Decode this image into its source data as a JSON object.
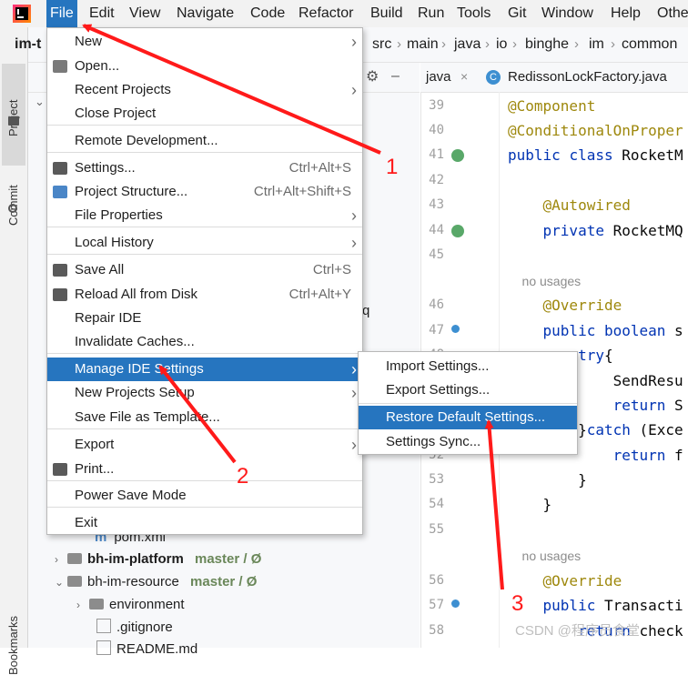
{
  "menubar": {
    "items": [
      "File",
      "Edit",
      "View",
      "Navigate",
      "Code",
      "Refactor",
      "Build",
      "Run",
      "Tools",
      "Git",
      "Window",
      "Help",
      "Othe"
    ]
  },
  "left_strip": {
    "project": "Project",
    "commit": "Commit",
    "bookmarks": "Bookmarks"
  },
  "navbar": {
    "project": "im-t",
    "crumbs": [
      "src",
      "main",
      "java",
      "io",
      "binghe",
      "im",
      "common"
    ]
  },
  "editor": {
    "tabs": [
      "java",
      "RedissonLockFactory.java"
    ],
    "lines": [
      {
        "n": "39",
        "code": "@Component"
      },
      {
        "n": "40",
        "code": "@ConditionalOnProper"
      },
      {
        "n": "41",
        "code": "public class RocketM"
      },
      {
        "n": "42",
        "code": ""
      },
      {
        "n": "43",
        "code": "    @Autowired"
      },
      {
        "n": "44",
        "code": "    private RocketMQ"
      },
      {
        "n": "45",
        "code": ""
      },
      {
        "n": "",
        "code": "    no usages"
      },
      {
        "n": "46",
        "code": "    @Override"
      },
      {
        "n": "47",
        "code": "    public boolean s"
      },
      {
        "n": "48",
        "code": "        try{"
      },
      {
        "n": "49",
        "code": "            SendResu"
      },
      {
        "n": "50",
        "code": "            return S"
      },
      {
        "n": "51",
        "code": "        }catch (Exce"
      },
      {
        "n": "52",
        "code": "            return f"
      },
      {
        "n": "53",
        "code": "        }"
      },
      {
        "n": "54",
        "code": "    }"
      },
      {
        "n": "55",
        "code": ""
      },
      {
        "n": "",
        "code": "    no usages"
      },
      {
        "n": "56",
        "code": "    @Override"
      },
      {
        "n": "57",
        "code": "    public Transacti"
      },
      {
        "n": "58",
        "code": "        return check"
      }
    ]
  },
  "tree": {
    "pom": "pom.xml",
    "platform": {
      "name": "bh-im-platform",
      "branch": "master / Ø"
    },
    "resource": {
      "name": "bh-im-resource",
      "branch": "master / Ø"
    },
    "environment": "environment",
    "gitignore": ".gitignore",
    "readme": "README.md",
    "fragment_q": "q",
    "fragment_c": "c"
  },
  "file_menu": {
    "items": [
      {
        "label": "New",
        "shortcut": "",
        "submenu": true
      },
      {
        "label": "Open...",
        "shortcut": "",
        "submenu": false
      },
      {
        "label": "Recent Projects",
        "shortcut": "",
        "submenu": true
      },
      {
        "label": "Close Project",
        "shortcut": "",
        "submenu": false
      },
      {
        "label": "Remote Development...",
        "shortcut": "",
        "submenu": false
      },
      {
        "label": "Settings...",
        "shortcut": "Ctrl+Alt+S",
        "submenu": false
      },
      {
        "label": "Project Structure...",
        "shortcut": "Ctrl+Alt+Shift+S",
        "submenu": false
      },
      {
        "label": "File Properties",
        "shortcut": "",
        "submenu": true
      },
      {
        "label": "Local History",
        "shortcut": "",
        "submenu": true
      },
      {
        "label": "Save All",
        "shortcut": "Ctrl+S",
        "submenu": false
      },
      {
        "label": "Reload All from Disk",
        "shortcut": "Ctrl+Alt+Y",
        "submenu": false
      },
      {
        "label": "Repair IDE",
        "shortcut": "",
        "submenu": false
      },
      {
        "label": "Invalidate Caches...",
        "shortcut": "",
        "submenu": false
      },
      {
        "label": "Manage IDE Settings",
        "shortcut": "",
        "submenu": true
      },
      {
        "label": "New Projects Setup",
        "shortcut": "",
        "submenu": true
      },
      {
        "label": "Save File as Template...",
        "shortcut": "",
        "submenu": false
      },
      {
        "label": "Export",
        "shortcut": "",
        "submenu": true
      },
      {
        "label": "Print...",
        "shortcut": "",
        "submenu": false
      },
      {
        "label": "Power Save Mode",
        "shortcut": "",
        "submenu": false
      },
      {
        "label": "Exit",
        "shortcut": "",
        "submenu": false
      }
    ]
  },
  "settings_submenu": {
    "items": [
      "Import Settings...",
      "Export Settings...",
      "Restore Default Settings...",
      "Settings Sync..."
    ]
  },
  "annotations": [
    "1",
    "2",
    "3"
  ],
  "watermark": "CSDN @程序员食堂",
  "colors": {
    "accent": "#2675bf",
    "arrow": "#ff1a1a",
    "keyword": "#0033b3",
    "annotation": "#9e880d"
  }
}
